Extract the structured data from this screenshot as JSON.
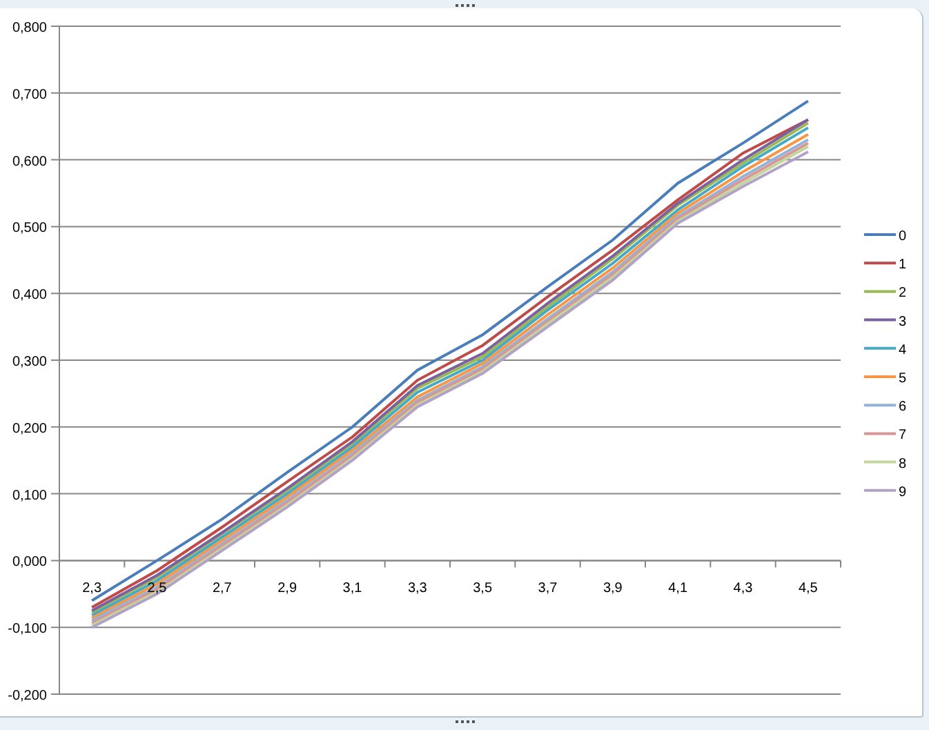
{
  "chart": {
    "chart_data": {
      "type": "line",
      "grid": true,
      "legend": "right",
      "categories": [
        "2,3",
        "2,5",
        "2,7",
        "2,9",
        "3,1",
        "3,3",
        "3,5",
        "3,7",
        "3,9",
        "4,1",
        "4,3",
        "4,5"
      ],
      "ylim": [
        -0.2,
        0.8
      ],
      "yticks": [
        {
          "value": -0.2,
          "label": "-0,200"
        },
        {
          "value": -0.1,
          "label": "-0,100"
        },
        {
          "value": 0,
          "label": "0,000"
        },
        {
          "value": 0.1,
          "label": "0,100"
        },
        {
          "value": 0.2,
          "label": "0,200"
        },
        {
          "value": 0.3,
          "label": "0,300"
        },
        {
          "value": 0.4,
          "label": "0,400"
        },
        {
          "value": 0.5,
          "label": "0,500"
        },
        {
          "value": 0.6,
          "label": "0,600"
        },
        {
          "value": 0.7,
          "label": "0,700"
        },
        {
          "value": 0.8,
          "label": "0,800"
        }
      ],
      "series": [
        {
          "name": "0",
          "color": "#4a7ebb",
          "values": [
            -0.06,
            0.0,
            0.062,
            0.132,
            0.2,
            0.285,
            0.338,
            0.41,
            0.48,
            0.565,
            0.625,
            0.688
          ]
        },
        {
          "name": "1",
          "color": "#be4b48",
          "values": [
            -0.07,
            -0.015,
            0.05,
            0.118,
            0.185,
            0.27,
            0.322,
            0.395,
            0.465,
            0.54,
            0.61,
            0.66
          ]
        },
        {
          "name": "2",
          "color": "#98b954",
          "values": [
            -0.078,
            -0.025,
            0.04,
            0.105,
            0.175,
            0.258,
            0.305,
            0.38,
            0.452,
            0.532,
            0.595,
            0.655
          ]
        },
        {
          "name": "3",
          "color": "#7d60a0",
          "values": [
            -0.075,
            -0.022,
            0.042,
            0.108,
            0.178,
            0.262,
            0.31,
            0.385,
            0.456,
            0.535,
            0.6,
            0.66
          ]
        },
        {
          "name": "4",
          "color": "#46aac5",
          "values": [
            -0.082,
            -0.03,
            0.035,
            0.1,
            0.17,
            0.252,
            0.3,
            0.375,
            0.445,
            0.525,
            0.59,
            0.648
          ]
        },
        {
          "name": "5",
          "color": "#f79646",
          "values": [
            -0.086,
            -0.035,
            0.03,
            0.095,
            0.165,
            0.245,
            0.295,
            0.368,
            0.438,
            0.52,
            0.582,
            0.638
          ]
        },
        {
          "name": "6",
          "color": "#95b3d7",
          "values": [
            -0.09,
            -0.04,
            0.025,
            0.09,
            0.16,
            0.24,
            0.29,
            0.362,
            0.432,
            0.515,
            0.575,
            0.63
          ]
        },
        {
          "name": "7",
          "color": "#d99694",
          "values": [
            -0.094,
            -0.043,
            0.022,
            0.087,
            0.157,
            0.237,
            0.287,
            0.358,
            0.428,
            0.512,
            0.57,
            0.625
          ]
        },
        {
          "name": "8",
          "color": "#c3d69b",
          "values": [
            -0.097,
            -0.047,
            0.018,
            0.083,
            0.153,
            0.233,
            0.283,
            0.354,
            0.424,
            0.508,
            0.565,
            0.62
          ]
        },
        {
          "name": "9",
          "color": "#b3a2c7",
          "values": [
            -0.1,
            -0.05,
            0.015,
            0.08,
            0.15,
            0.23,
            0.28,
            0.35,
            0.42,
            0.505,
            0.56,
            0.612
          ]
        }
      ]
    }
  }
}
